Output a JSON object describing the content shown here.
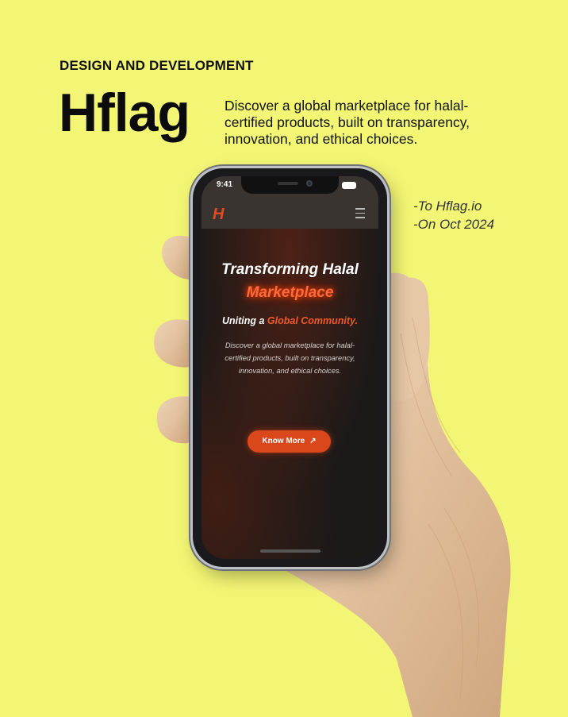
{
  "header": {
    "kicker": "DESIGN AND DEVELOPMENT",
    "brand": "Hflag",
    "description": "Discover a global marketplace for halal-certified products, built on transparency, innovation, and ethical choices."
  },
  "meta": {
    "line1": "-To Hflag.io",
    "line2": "-On Oct 2024"
  },
  "phone": {
    "status": {
      "time": "9:41"
    },
    "nav": {
      "logo": "H",
      "menu_icon": "hamburger-icon"
    },
    "hero": {
      "title_line1": "Transforming Halal",
      "title_line2": "Marketplace",
      "subtitle_prefix": "Uniting a ",
      "subtitle_accent": "Global Community.",
      "body": "Discover a global marketplace for halal-certified products, built on transparency, innovation, and ethical choices.",
      "cta_label": "Know More",
      "cta_icon": "arrow-up-right-icon"
    }
  },
  "colors": {
    "background": "#f3f574",
    "accent": "#d9471b",
    "glow": "#ff6a3a",
    "screen_bg": "#1b1918"
  }
}
